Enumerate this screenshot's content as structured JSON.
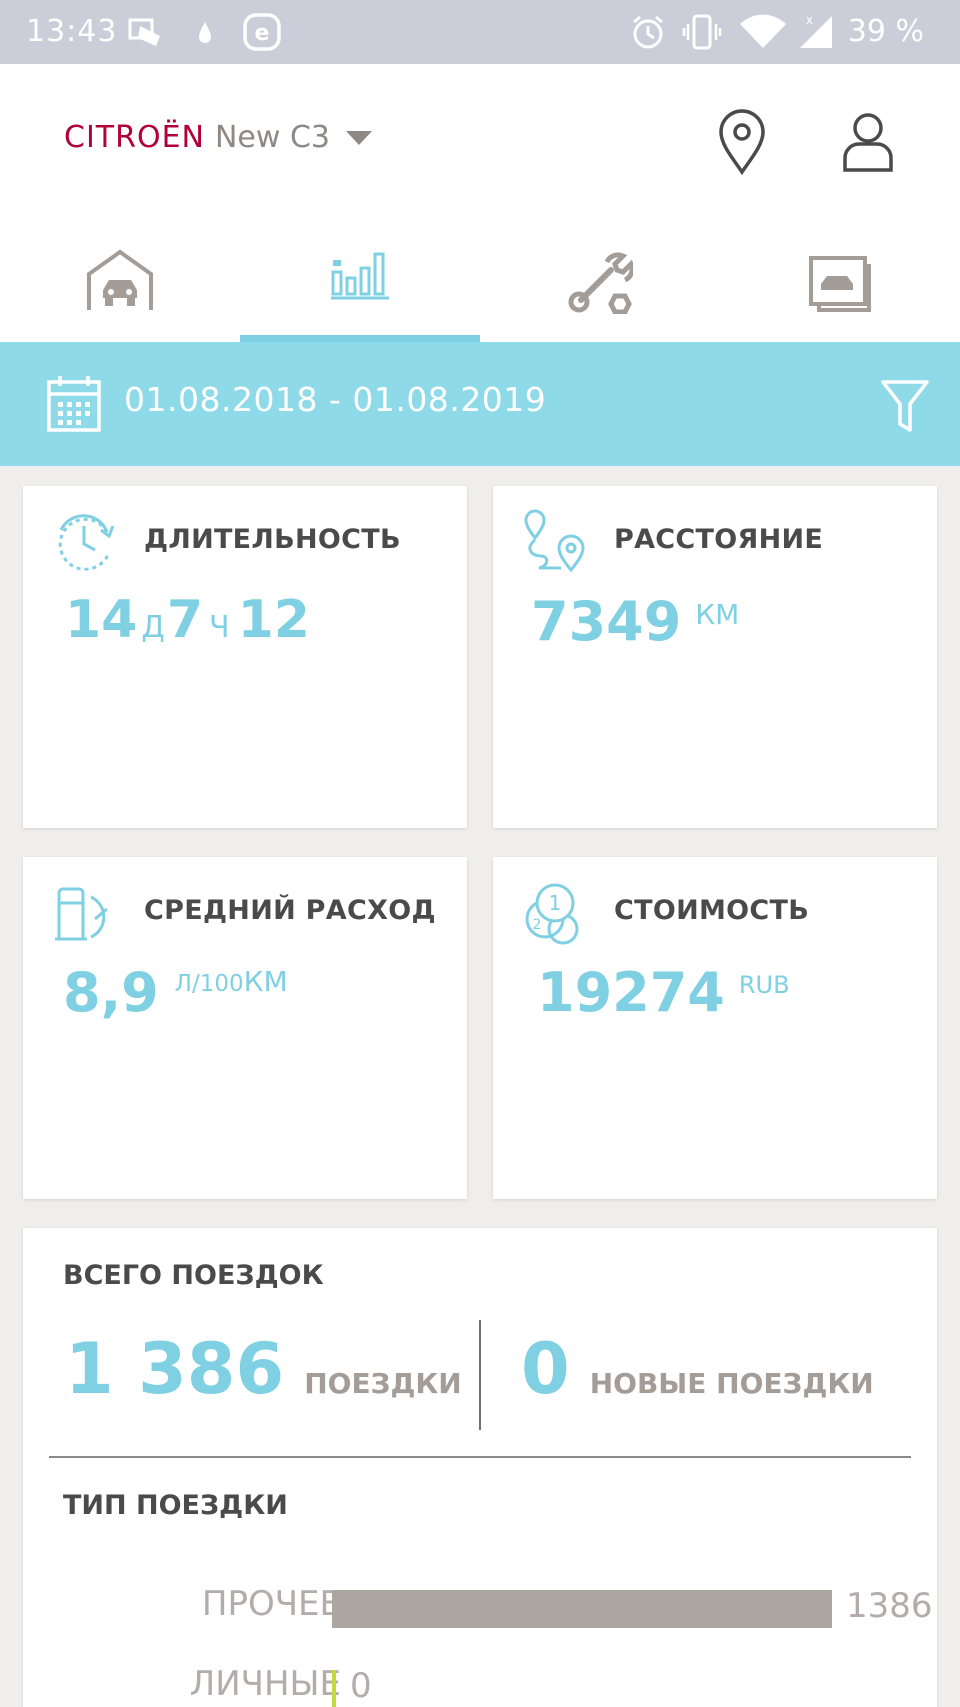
{
  "status_bar": {
    "time": "13:43",
    "battery": "39 %"
  },
  "header": {
    "brand": "CITROËN",
    "model": "New C3"
  },
  "icons": {
    "location": "location-pin-icon",
    "profile": "profile-icon",
    "garage": "garage-icon",
    "stats": "statistics-icon",
    "service": "wrench-icon",
    "documents": "car-documents-icon",
    "calendar": "calendar-icon",
    "filter": "filter-icon"
  },
  "tabs": {
    "active_index": 1
  },
  "date_range": "01.08.2018 - 01.08.2019",
  "cards": {
    "duration": {
      "title": "ДЛИТЕЛЬНОСТЬ",
      "days": "14",
      "days_unit": "Д",
      "hours": "7",
      "hours_unit": "Ч",
      "minutes": "12"
    },
    "distance": {
      "title": "РАССТОЯНИЕ",
      "value": "7349",
      "unit": "КМ"
    },
    "consumption": {
      "title": "СРЕДНИЙ РАСХОД",
      "value": "8,9",
      "unit_l": "Л/100",
      "unit_km": "КМ"
    },
    "cost": {
      "title": "СТОИМОСТЬ",
      "value": "19274",
      "unit": "RUB"
    }
  },
  "trips": {
    "title": "ВСЕГО ПОЕЗДОК",
    "count": "1 386",
    "count_label": "ПОЕЗДКИ",
    "new_count": "0",
    "new_label": "НОВЫЕ ПОЕЗДКИ",
    "type_title": "ТИП ПОЕЗДКИ",
    "types": [
      {
        "label": "ПРОЧЕЕ",
        "value": 1386,
        "display": "1386"
      },
      {
        "label": "ЛИЧНЫЕ",
        "value": 0,
        "display": "0"
      }
    ]
  },
  "colors": {
    "accent": "#7fd0e2",
    "brand": "#b1003a",
    "bar": "#aca6a1",
    "personal_bar": "#c4d93c"
  }
}
